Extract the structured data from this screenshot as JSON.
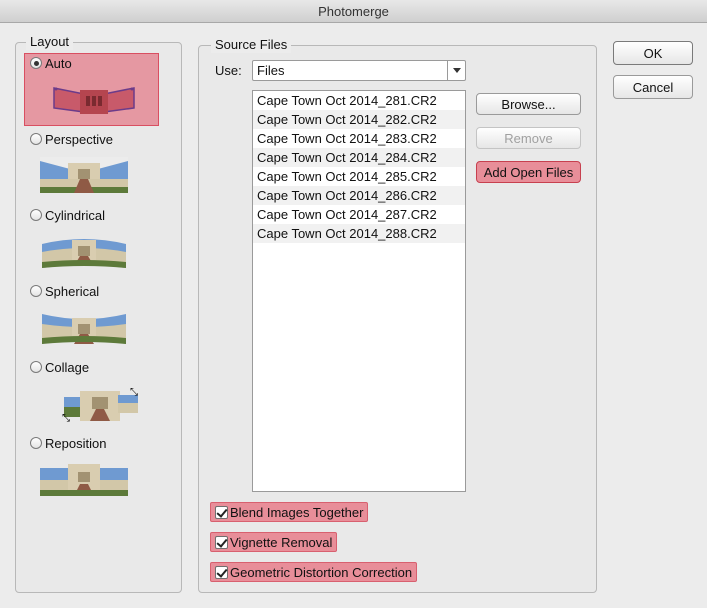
{
  "window": {
    "title": "Photomerge"
  },
  "layout": {
    "legend": "Layout",
    "options": [
      {
        "label": "Auto",
        "selected": true
      },
      {
        "label": "Perspective",
        "selected": false
      },
      {
        "label": "Cylindrical",
        "selected": false
      },
      {
        "label": "Spherical",
        "selected": false
      },
      {
        "label": "Collage",
        "selected": false
      },
      {
        "label": "Reposition",
        "selected": false
      }
    ]
  },
  "source_files": {
    "legend": "Source Files",
    "use_label": "Use:",
    "use_value": "Files",
    "files": [
      "Cape Town Oct 2014_281.CR2",
      "Cape Town Oct 2014_282.CR2",
      "Cape Town Oct 2014_283.CR2",
      "Cape Town Oct 2014_284.CR2",
      "Cape Town Oct 2014_285.CR2",
      "Cape Town Oct 2014_286.CR2",
      "Cape Town Oct 2014_287.CR2",
      "Cape Town Oct 2014_288.CR2"
    ],
    "browse_label": "Browse...",
    "remove_label": "Remove",
    "add_open_label": "Add Open Files"
  },
  "options": {
    "blend": "Blend Images Together",
    "vignette": "Vignette Removal",
    "geometric": "Geometric Distortion Correction"
  },
  "actions": {
    "ok": "OK",
    "cancel": "Cancel"
  },
  "colors": {
    "highlight": "#e88e99",
    "dialog_bg": "#ececec"
  }
}
